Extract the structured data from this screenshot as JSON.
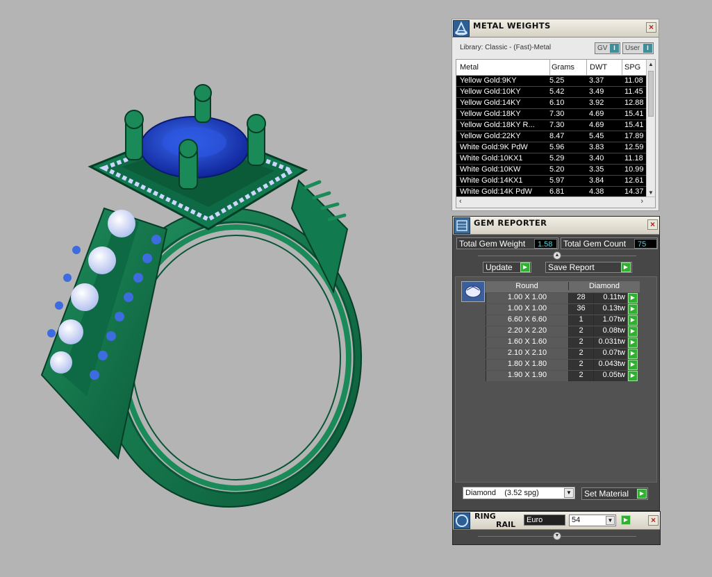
{
  "metal_weights": {
    "title": "METAL WEIGHTS",
    "library_label": "Library: Classic - (Fast)-Metal",
    "toggle_gv": "GV",
    "toggle_user": "User",
    "columns": [
      "Metal",
      "Grams",
      "DWT",
      "SPG"
    ],
    "rows": [
      {
        "metal": "Yellow Gold:9KY",
        "grams": "5.25",
        "dwt": "3.37",
        "spg": "11.08"
      },
      {
        "metal": "Yellow Gold:10KY",
        "grams": "5.42",
        "dwt": "3.49",
        "spg": "11.45"
      },
      {
        "metal": "Yellow Gold:14KY",
        "grams": "6.10",
        "dwt": "3.92",
        "spg": "12.88"
      },
      {
        "metal": "Yellow Gold:18KY",
        "grams": "7.30",
        "dwt": "4.69",
        "spg": "15.41"
      },
      {
        "metal": "Yellow Gold:18KY R...",
        "grams": "7.30",
        "dwt": "4.69",
        "spg": "15.41"
      },
      {
        "metal": "Yellow Gold:22KY",
        "grams": "8.47",
        "dwt": "5.45",
        "spg": "17.89"
      },
      {
        "metal": "White Gold:9K PdW",
        "grams": "5.96",
        "dwt": "3.83",
        "spg": "12.59"
      },
      {
        "metal": "White Gold:10KX1",
        "grams": "5.29",
        "dwt": "3.40",
        "spg": "11.18"
      },
      {
        "metal": "White Gold:10KW",
        "grams": "5.20",
        "dwt": "3.35",
        "spg": "10.99"
      },
      {
        "metal": "White Gold:14KX1",
        "grams": "5.97",
        "dwt": "3.84",
        "spg": "12.61"
      },
      {
        "metal": "White Gold:14K PdW",
        "grams": "6.81",
        "dwt": "4.38",
        "spg": "14.37"
      }
    ]
  },
  "gem_reporter": {
    "title": "GEM REPORTER",
    "total_weight_label": "Total Gem Weight",
    "total_weight_value": "1.58",
    "total_count_label": "Total Gem Count",
    "total_count_value": "75",
    "update_label": "Update",
    "save_report_label": "Save Report",
    "col_shape": "Round",
    "col_material": "Diamond",
    "gems": [
      {
        "size": "1.00 X 1.00",
        "count": "28",
        "weight": "0.11tw"
      },
      {
        "size": "1.00 X 1.00",
        "count": "36",
        "weight": "0.13tw"
      },
      {
        "size": "6.60 X 6.60",
        "count": "1",
        "weight": "1.07tw"
      },
      {
        "size": "2.20 X 2.20",
        "count": "2",
        "weight": "0.08tw"
      },
      {
        "size": "1.60 X 1.60",
        "count": "2",
        "weight": "0.031tw"
      },
      {
        "size": "2.10 X 2.10",
        "count": "2",
        "weight": "0.07tw"
      },
      {
        "size": "1.80 X 1.80",
        "count": "2",
        "weight": "0.043tw"
      },
      {
        "size": "1.90 X 1.90",
        "count": "2",
        "weight": "0.05tw"
      }
    ],
    "material_select": "Diamond    (3.52 spg)",
    "set_material_label": "Set Material"
  },
  "ring_rail": {
    "title_line1": "RING",
    "title_line2": "RAIL",
    "standard": "Euro",
    "size": "54"
  },
  "colors": {
    "ring_green": "#127a4f",
    "gem_blue": "#1a3fc8",
    "panel_dark": "#474747",
    "value_cyan": "#5fd0d8",
    "play_green": "#2fb12f"
  }
}
